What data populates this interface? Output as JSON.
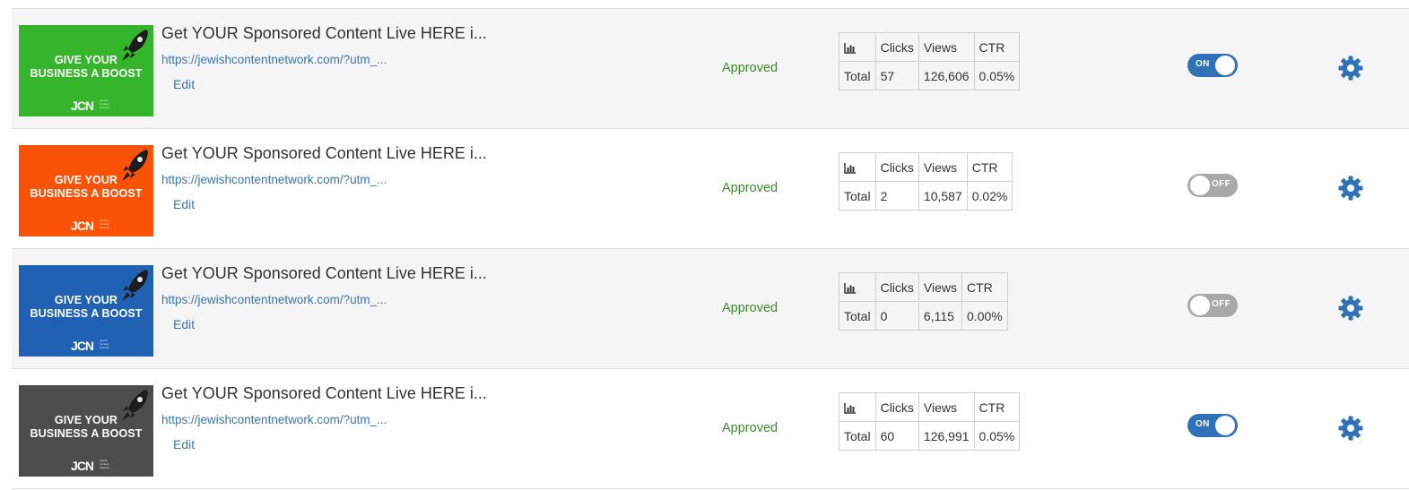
{
  "colors": {
    "link": "#3a75b0",
    "approved": "#3c8a2e",
    "toggle_on": "#2f72b8",
    "toggle_off": "#a8a8a8",
    "gear": "#2f72b8"
  },
  "stats_headers": {
    "icon": "bar-chart-icon",
    "clicks": "Clicks",
    "views": "Views",
    "ctr": "CTR",
    "row_label": "Total"
  },
  "ads": [
    {
      "thumb_color": "#34b52b",
      "thumb_headline_1": "GIVE YOUR",
      "thumb_headline_2": "BUSINESS A BOOST",
      "thumb_logo": "JCN",
      "thumb_logo_sub": "Jewish Content Network",
      "title": "Get YOUR Sponsored Content Live HERE i...",
      "url": "https://jewishcontentnetwork.com/?utm_...",
      "edit_label": "Edit",
      "status": "Approved",
      "clicks": "57",
      "views": "126,606",
      "ctr": "0.05%",
      "toggle_state": "ON",
      "toggle_on": true
    },
    {
      "thumb_color": "#fa5206",
      "thumb_headline_1": "GIVE YOUR",
      "thumb_headline_2": "BUSINESS A BOOST",
      "thumb_logo": "JCN",
      "thumb_logo_sub": "Jewish Content Network",
      "title": "Get YOUR Sponsored Content Live HERE i...",
      "url": "https://jewishcontentnetwork.com/?utm_...",
      "edit_label": "Edit",
      "status": "Approved",
      "clicks": "2",
      "views": "10,587",
      "ctr": "0.02%",
      "toggle_state": "OFF",
      "toggle_on": false
    },
    {
      "thumb_color": "#2061b3",
      "thumb_headline_1": "GIVE YOUR",
      "thumb_headline_2": "BUSINESS A BOOST",
      "thumb_logo": "JCN",
      "thumb_logo_sub": "Jewish Content Network",
      "title": "Get YOUR Sponsored Content Live HERE i...",
      "url": "https://jewishcontentnetwork.com/?utm_...",
      "edit_label": "Edit",
      "status": "Approved",
      "clicks": "0",
      "views": "6,115",
      "ctr": "0.00%",
      "toggle_state": "OFF",
      "toggle_on": false
    },
    {
      "thumb_color": "#4d4d4d",
      "thumb_headline_1": "GIVE YOUR",
      "thumb_headline_2": "BUSINESS A BOOST",
      "thumb_logo": "JCN",
      "thumb_logo_sub": "Jewish Content Network",
      "title": "Get YOUR Sponsored Content Live HERE i...",
      "url": "https://jewishcontentnetwork.com/?utm_...",
      "edit_label": "Edit",
      "status": "Approved",
      "clicks": "60",
      "views": "126,991",
      "ctr": "0.05%",
      "toggle_state": "ON",
      "toggle_on": true
    }
  ]
}
